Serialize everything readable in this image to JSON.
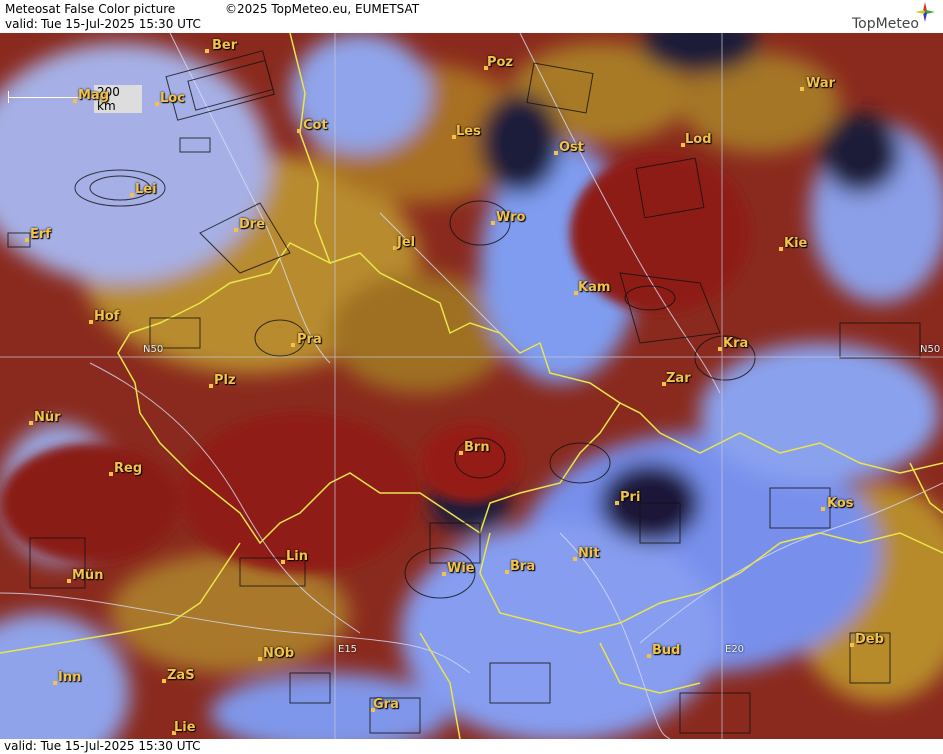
{
  "header": {
    "title": "Meteosat False Color picture",
    "copyright": "©2025 TopMeteo.eu, EUMETSAT",
    "valid_label": "valid:",
    "valid_time": "Tue  15-Jul-2025  15:30 UTC",
    "logo_text": "TopMeteo"
  },
  "footer": {
    "valid": "valid:  Tue  15-Jul-2025  15:30 UTC"
  },
  "scale": {
    "label": "200 km"
  },
  "grid_labels": {
    "n50_left": "N50",
    "n50_right": "N50",
    "e15": "E15",
    "e20": "E20"
  },
  "cities": [
    "Ber",
    "Poz",
    "Mag",
    "Loc",
    "Cot",
    "War",
    "Les",
    "Ost",
    "Lod",
    "Lei",
    "Wro",
    "Erf",
    "Dre",
    "Jel",
    "Kie",
    "Kam",
    "Hof",
    "Pra",
    "Kra",
    "Plz",
    "Zar",
    "Nür",
    "Brn",
    "Reg",
    "Pri",
    "Kos",
    "Lin",
    "Nit",
    "Mün",
    "Wie",
    "Bra",
    "Bud",
    "NOb",
    "Deb",
    "Inn",
    "ZaS",
    "Gra",
    "Lie"
  ],
  "colors": {
    "cloud_blue": "#7f9cf0",
    "land_red": "#8a1b14",
    "land_ochre": "#b78b2a",
    "border_yellow": "#e9e54a",
    "city_label": "#f3c24a"
  }
}
